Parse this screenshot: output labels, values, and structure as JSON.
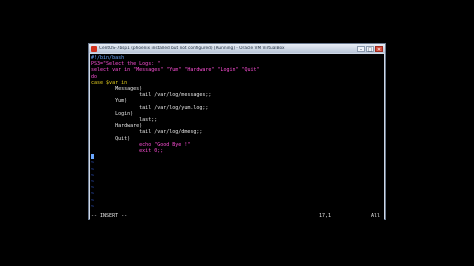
{
  "window": {
    "title": "CentOS-7bsp1 (phoenix installed but not configured) [Running] - Oracle VM VirtualBox",
    "buttons": [
      "–",
      "□",
      "✕"
    ],
    "icon": "virtualbox-icon"
  },
  "editor": {
    "lines": [
      {
        "text": "#!/bin/bash",
        "color": "blue"
      },
      {
        "text": "PS3=\"Select the Logs: \"",
        "color": "magenta"
      },
      {
        "text": "select var in \"Messages\" \"Yum\" \"Hardware\" \"Login\" \"Quit\"",
        "color": "magenta"
      },
      {
        "text": "do",
        "color": "magenta"
      },
      {
        "text": "case $var in",
        "color": "yellow"
      },
      {
        "text": "        Messages)",
        "color": "white"
      },
      {
        "text": "                tail /var/log/messages;;",
        "color": "white"
      },
      {
        "text": "        Yum)",
        "color": "white"
      },
      {
        "text": "                tail /var/log/yum.log;;",
        "color": "white"
      },
      {
        "text": "        Login)",
        "color": "white"
      },
      {
        "text": "                last;;",
        "color": "white"
      },
      {
        "text": "        Hardware)",
        "color": "white"
      },
      {
        "text": "                tail /var/log/dmesg;;",
        "color": "white"
      },
      {
        "text": "        Quit)",
        "color": "white"
      },
      {
        "text": "                echo \"Good Bye !\"",
        "color": "magenta"
      },
      {
        "text": "                exit 0;;",
        "color": "magenta"
      },
      {
        "text": "",
        "color": "white"
      }
    ],
    "tilde": "~"
  },
  "status": {
    "mode": "-- INSERT --",
    "position": "17,1",
    "scroll": "All"
  }
}
